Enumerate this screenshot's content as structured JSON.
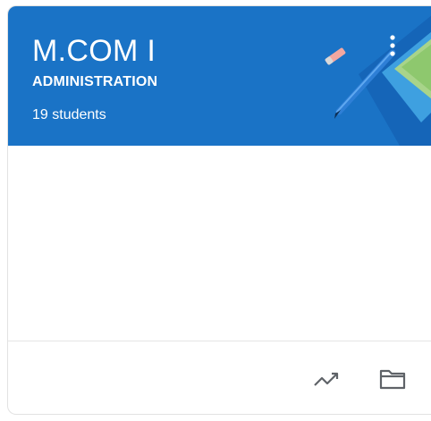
{
  "course": {
    "title": "M.COM I",
    "section": "ADMINISTRATION",
    "students": "19 students",
    "header_color": "#1a73c6"
  },
  "actions": {
    "more_icon": "more-vert-icon",
    "trend_icon": "trending-up-icon",
    "folder_icon": "folder-icon"
  }
}
